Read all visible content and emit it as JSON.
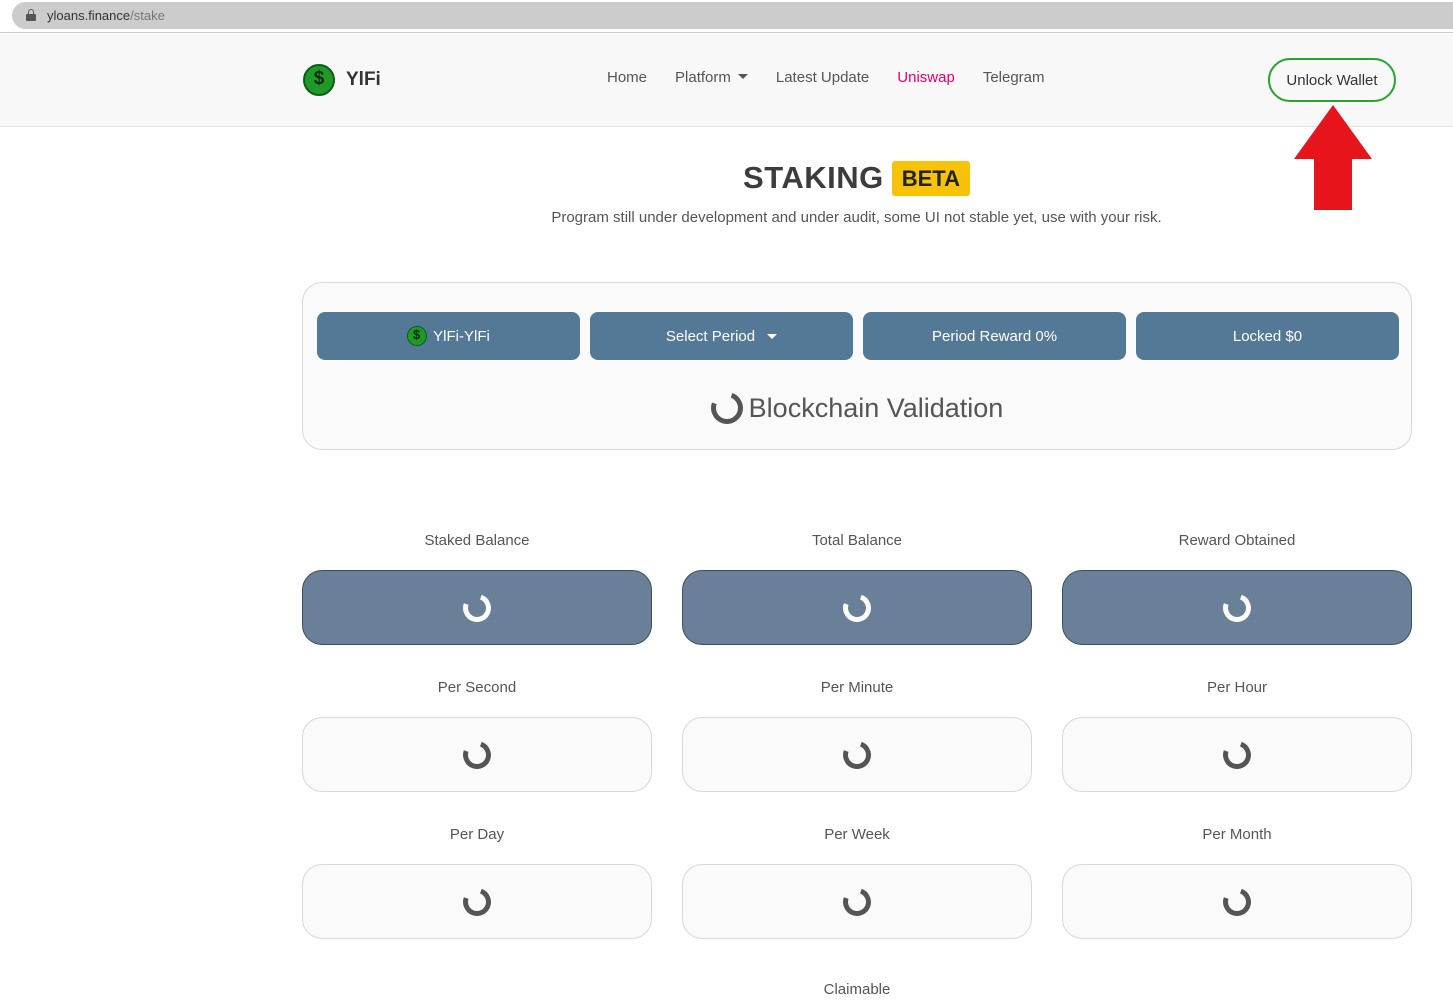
{
  "browser": {
    "url_host": "yloans.finance",
    "url_path": "/stake"
  },
  "navbar": {
    "brand": "YlFi",
    "links": [
      {
        "label": "Home"
      },
      {
        "label": "Platform"
      },
      {
        "label": "Latest Update"
      },
      {
        "label": "Uniswap"
      },
      {
        "label": "Telegram"
      }
    ],
    "unlock_label": "Unlock Wallet"
  },
  "header": {
    "title": "STAKING",
    "badge": "BETA",
    "subtitle": "Program still under development and under audit, some UI not stable yet, use with your risk."
  },
  "controls": {
    "pair": "YlFi-YlFi",
    "period": "Select Period",
    "reward": "Period Reward 0%",
    "locked": "Locked $0",
    "validation": "Blockchain Validation"
  },
  "stats": {
    "staked_balance": "Staked Balance",
    "total_balance": "Total Balance",
    "reward_obtained": "Reward Obtained",
    "per_second": "Per Second",
    "per_minute": "Per Minute",
    "per_hour": "Per Hour",
    "per_day": "Per Day",
    "per_week": "Per Week",
    "per_month": "Per Month",
    "claimable": "Claimable"
  },
  "colors": {
    "accent_green": "#27a52a",
    "control_blue": "#547996",
    "uniswap_pink": "#e8006e",
    "beta_yellow": "#f8c208",
    "annotation_red": "#e8141c"
  },
  "icons": [
    "lock-icon",
    "yifi-logo-icon",
    "caret-down-icon",
    "loading-spinner-icon",
    "red-arrow-annotation"
  ]
}
